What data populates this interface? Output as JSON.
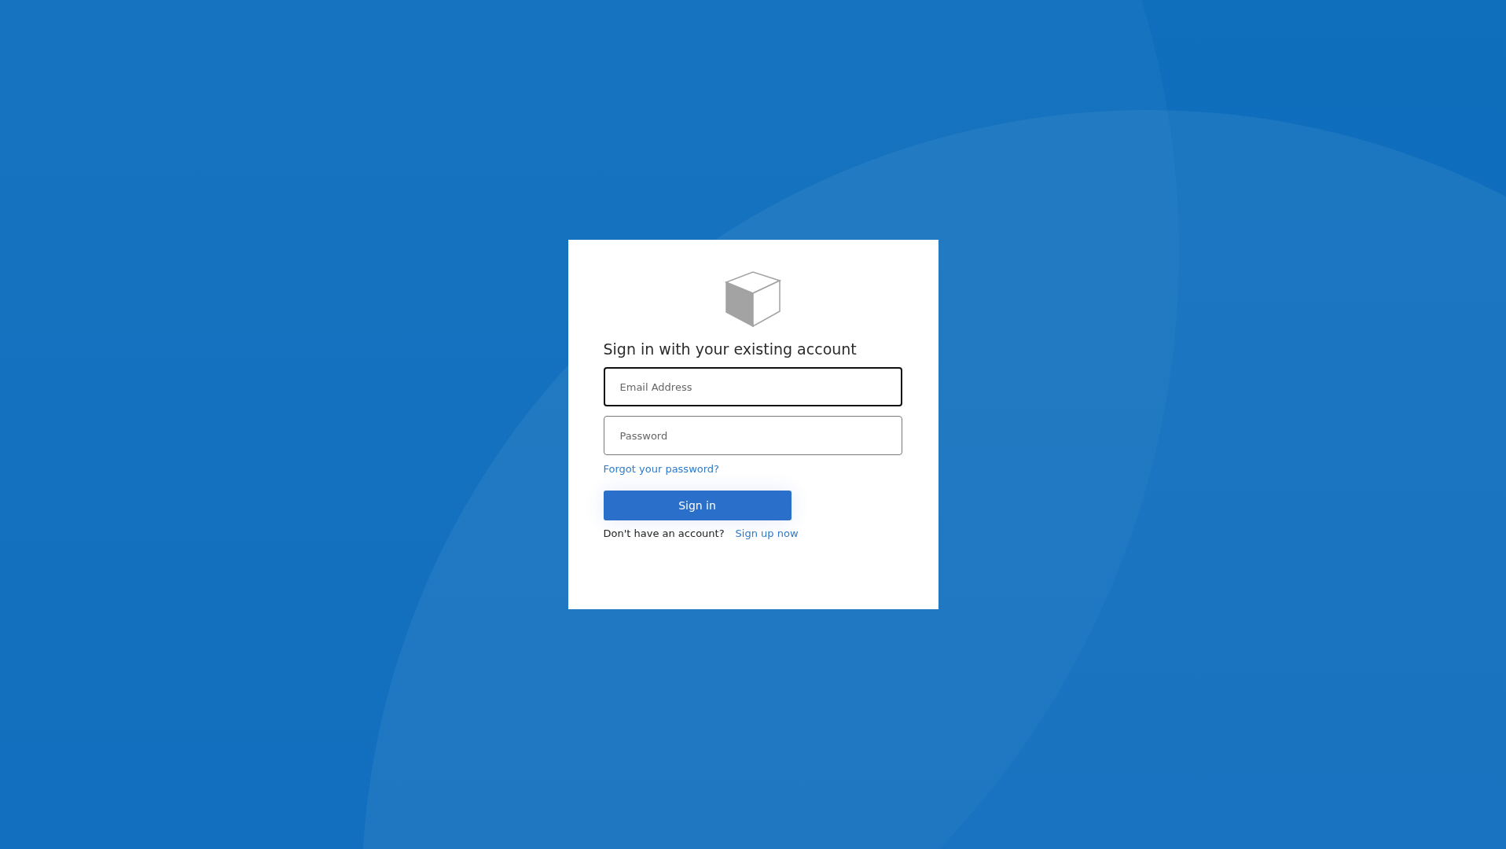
{
  "heading": "Sign in with your existing account",
  "fields": [
    {
      "placeholder": "Email Address",
      "focused": true
    },
    {
      "placeholder": "Password",
      "focused": false
    }
  ],
  "forgot_link": "Forgot your password?",
  "submit_button": "Sign in",
  "signup": {
    "prompt": "Don't have an account?",
    "link": "Sign up now"
  }
}
